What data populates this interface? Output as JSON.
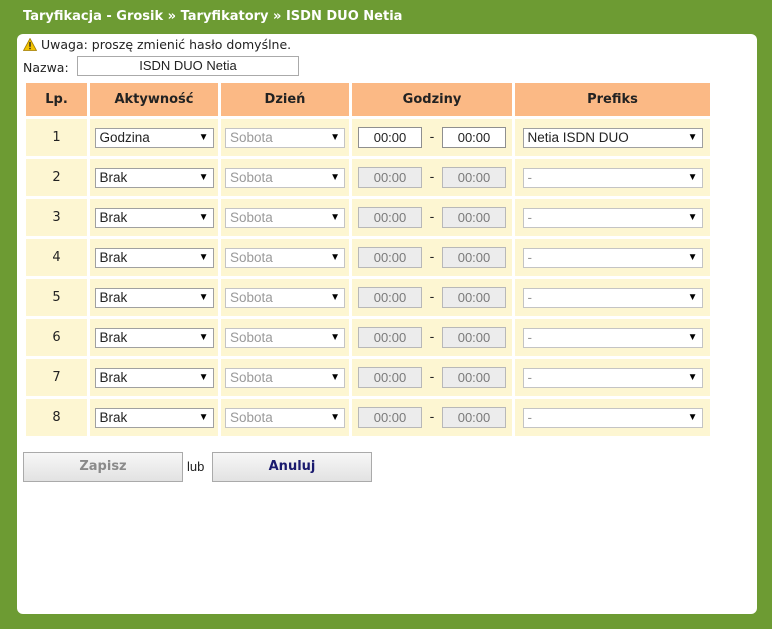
{
  "breadcrumb": "Taryfikacja - Grosik » Taryfikatory » ISDN DUO Netia",
  "warning": "Uwaga: proszę zmienić hasło domyślne.",
  "name_label": "Nazwa:",
  "name_value": "ISDN DUO Netia",
  "columns": [
    "Lp.",
    "Aktywność",
    "Dzień",
    "Godziny",
    "Prefiks"
  ],
  "time_separator": "-",
  "rows": [
    {
      "lp": "1",
      "activity": "Godzina",
      "day": "Sobota",
      "from": "00:00",
      "to": "00:00",
      "prefix": "Netia ISDN DUO",
      "enabled": true
    },
    {
      "lp": "2",
      "activity": "Brak",
      "day": "Sobota",
      "from": "00:00",
      "to": "00:00",
      "prefix": "-",
      "enabled": false
    },
    {
      "lp": "3",
      "activity": "Brak",
      "day": "Sobota",
      "from": "00:00",
      "to": "00:00",
      "prefix": "-",
      "enabled": false
    },
    {
      "lp": "4",
      "activity": "Brak",
      "day": "Sobota",
      "from": "00:00",
      "to": "00:00",
      "prefix": "-",
      "enabled": false
    },
    {
      "lp": "5",
      "activity": "Brak",
      "day": "Sobota",
      "from": "00:00",
      "to": "00:00",
      "prefix": "-",
      "enabled": false
    },
    {
      "lp": "6",
      "activity": "Brak",
      "day": "Sobota",
      "from": "00:00",
      "to": "00:00",
      "prefix": "-",
      "enabled": false
    },
    {
      "lp": "7",
      "activity": "Brak",
      "day": "Sobota",
      "from": "00:00",
      "to": "00:00",
      "prefix": "-",
      "enabled": false
    },
    {
      "lp": "8",
      "activity": "Brak",
      "day": "Sobota",
      "from": "00:00",
      "to": "00:00",
      "prefix": "-",
      "enabled": false
    }
  ],
  "buttons": {
    "save": "Zapisz",
    "or": "lub",
    "cancel": "Anuluj"
  },
  "colors": {
    "frame": "#6d9b33",
    "header": "#fbb985",
    "row": "#fdf6d2"
  },
  "icons": {
    "warning": "warning-icon",
    "dropdown": "chevron-down-icon"
  }
}
